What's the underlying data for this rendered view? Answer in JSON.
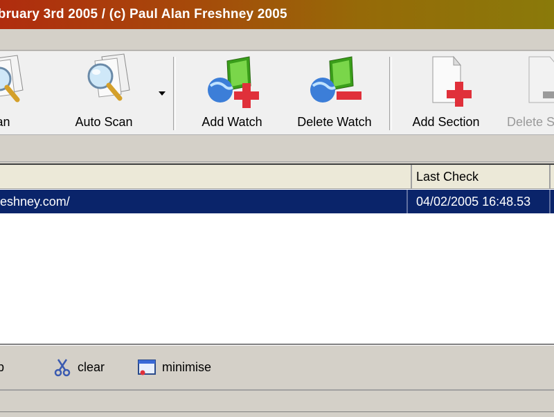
{
  "window": {
    "title": "ebruary 3rd 2005 / (c) Paul Alan Freshney 2005"
  },
  "toolbar": {
    "buttons": [
      {
        "label": "can",
        "icon": "scan-icon"
      },
      {
        "label": "Auto Scan",
        "icon": "auto-scan-icon"
      },
      {
        "label": "Add Watch",
        "icon": "add-watch-icon"
      },
      {
        "label": "Delete Watch",
        "icon": "delete-watch-icon"
      },
      {
        "label": "Add Section",
        "icon": "add-section-icon"
      },
      {
        "label": "Delete S",
        "icon": "delete-section-icon"
      }
    ]
  },
  "list": {
    "columns": [
      "",
      "Last Check"
    ],
    "rows": [
      {
        "url": "eshney.com/",
        "last_check": "04/02/2005 16:48.53"
      }
    ]
  },
  "bottom": {
    "buttons": [
      {
        "label": "p"
      },
      {
        "label": "clear",
        "icon": "scissors-icon"
      },
      {
        "label": "minimise",
        "icon": "minimise-window-icon"
      }
    ]
  }
}
